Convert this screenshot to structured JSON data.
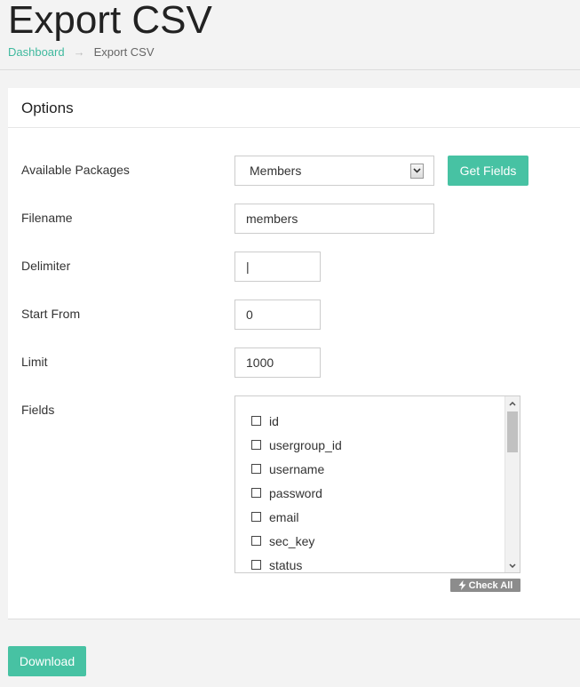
{
  "page": {
    "title": "Export CSV"
  },
  "breadcrumb": {
    "home": "Dashboard",
    "separator": "→",
    "current": "Export CSV"
  },
  "panel": {
    "title": "Options"
  },
  "form": {
    "packages_label": "Available Packages",
    "packages_value": "Members",
    "get_fields_label": "Get Fields",
    "filename_label": "Filename",
    "filename_value": "members",
    "delimiter_label": "Delimiter",
    "delimiter_value": "|",
    "start_from_label": "Start From",
    "start_from_value": "0",
    "limit_label": "Limit",
    "limit_value": "1000",
    "fields_label": "Fields",
    "fields": [
      "id",
      "usergroup_id",
      "username",
      "password",
      "email",
      "sec_key",
      "status"
    ],
    "check_all_label": "Check All",
    "download_label": "Download"
  },
  "colors": {
    "accent": "#47c2a3",
    "link": "#3fb99e",
    "badge": "#8c8c8c"
  }
}
